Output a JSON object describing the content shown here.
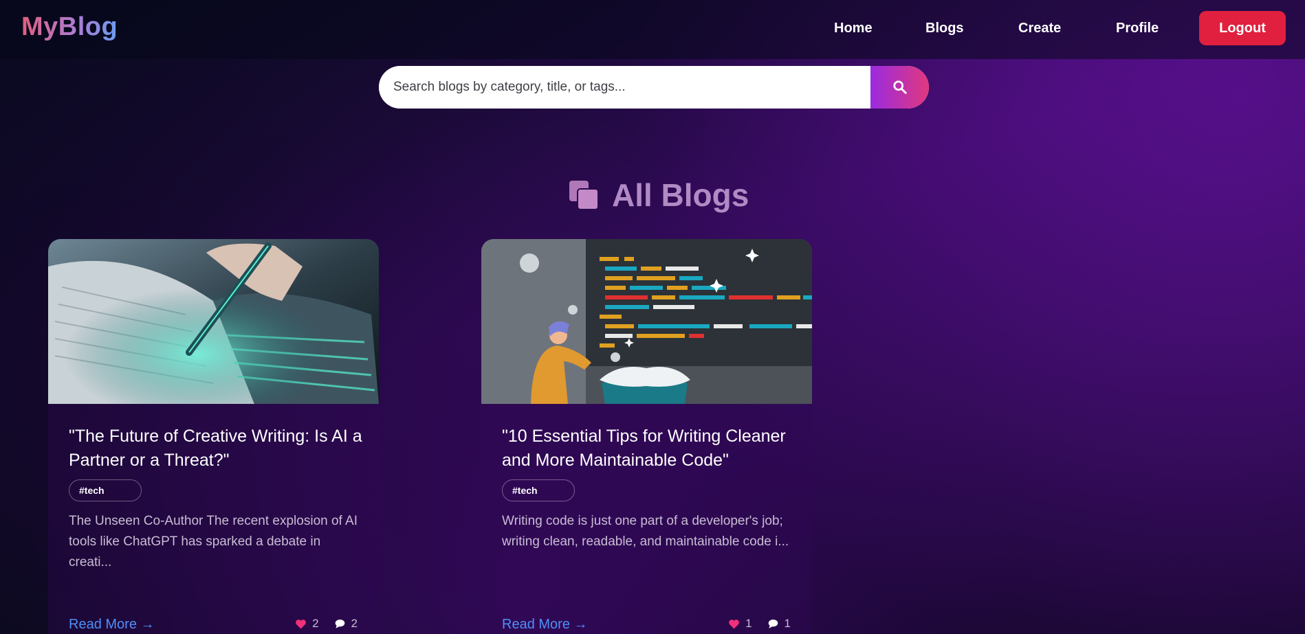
{
  "navbar": {
    "brand": "MyBlog",
    "links": {
      "home": "Home",
      "blogs": "Blogs",
      "create": "Create",
      "profile": "Profile"
    },
    "logout_label": "Logout"
  },
  "search": {
    "placeholder": "Search blogs by category, title, or tags...",
    "icon": "search-icon"
  },
  "section": {
    "icon": "copy-icon",
    "title": "All Blogs"
  },
  "colors": {
    "accent_logout": "#e0203e",
    "link_blue": "#4f8ff7",
    "heart_pink": "#f0307a",
    "title_lavender": "#b18ac5"
  },
  "blogs": [
    {
      "title": "\"The Future of Creative Writing: Is AI a Partner or a Threat?\"",
      "tag": "#tech",
      "excerpt": "The Unseen Co-Author The recent explosion of AI tools like ChatGPT has sparked a debate in creati...",
      "read_more": "Read More →",
      "likes": "2",
      "comments": "2",
      "image": "hand-writing-glowing-book-illustration"
    },
    {
      "title": "\"10 Essential Tips for Writing Cleaner and More Maintainable Code\"",
      "tag": "#tech",
      "excerpt": "Writing code is just one part of a developer's job; writing clean, readable, and maintainable code i...",
      "read_more": "Read More →",
      "likes": "1",
      "comments": "1",
      "image": "developer-code-screen-illustration"
    }
  ]
}
